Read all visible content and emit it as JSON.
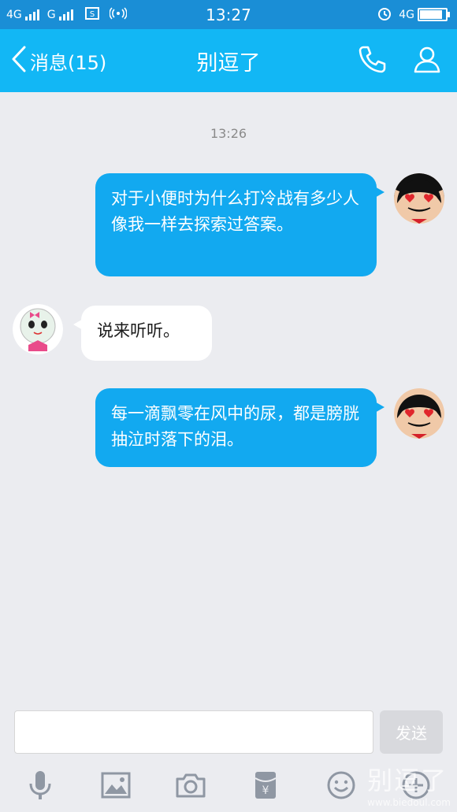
{
  "status": {
    "network1": "4G",
    "network2": "G",
    "time": "13:27",
    "network3": "4G",
    "battery_level": 0.92
  },
  "nav": {
    "back_label": "消息(15)",
    "title": "别逗了"
  },
  "conversation": {
    "timestamp": "13:26",
    "messages": [
      {
        "side": "sent",
        "text": "对于小便时为什么打冷战有多少人像我一样去探索过答案。"
      },
      {
        "side": "received",
        "text": "说来听听。"
      },
      {
        "side": "sent",
        "text": "每一滴飘零在风中的尿，都是膀胱抽泣时落下的泪。"
      }
    ]
  },
  "composer": {
    "input_value": "",
    "send_label": "发送"
  },
  "toolbar": {
    "icons": [
      "microphone-icon",
      "image-icon",
      "camera-icon",
      "red-packet-icon",
      "emoji-icon",
      "plus-icon"
    ]
  },
  "watermark": {
    "text": "别逗了",
    "url": "www.biedoul.com"
  },
  "colors": {
    "status_bar": "#1a8ed6",
    "nav_bar": "#12b7f5",
    "sent_bubble": "#12a9f0",
    "background": "#ebecf0"
  }
}
